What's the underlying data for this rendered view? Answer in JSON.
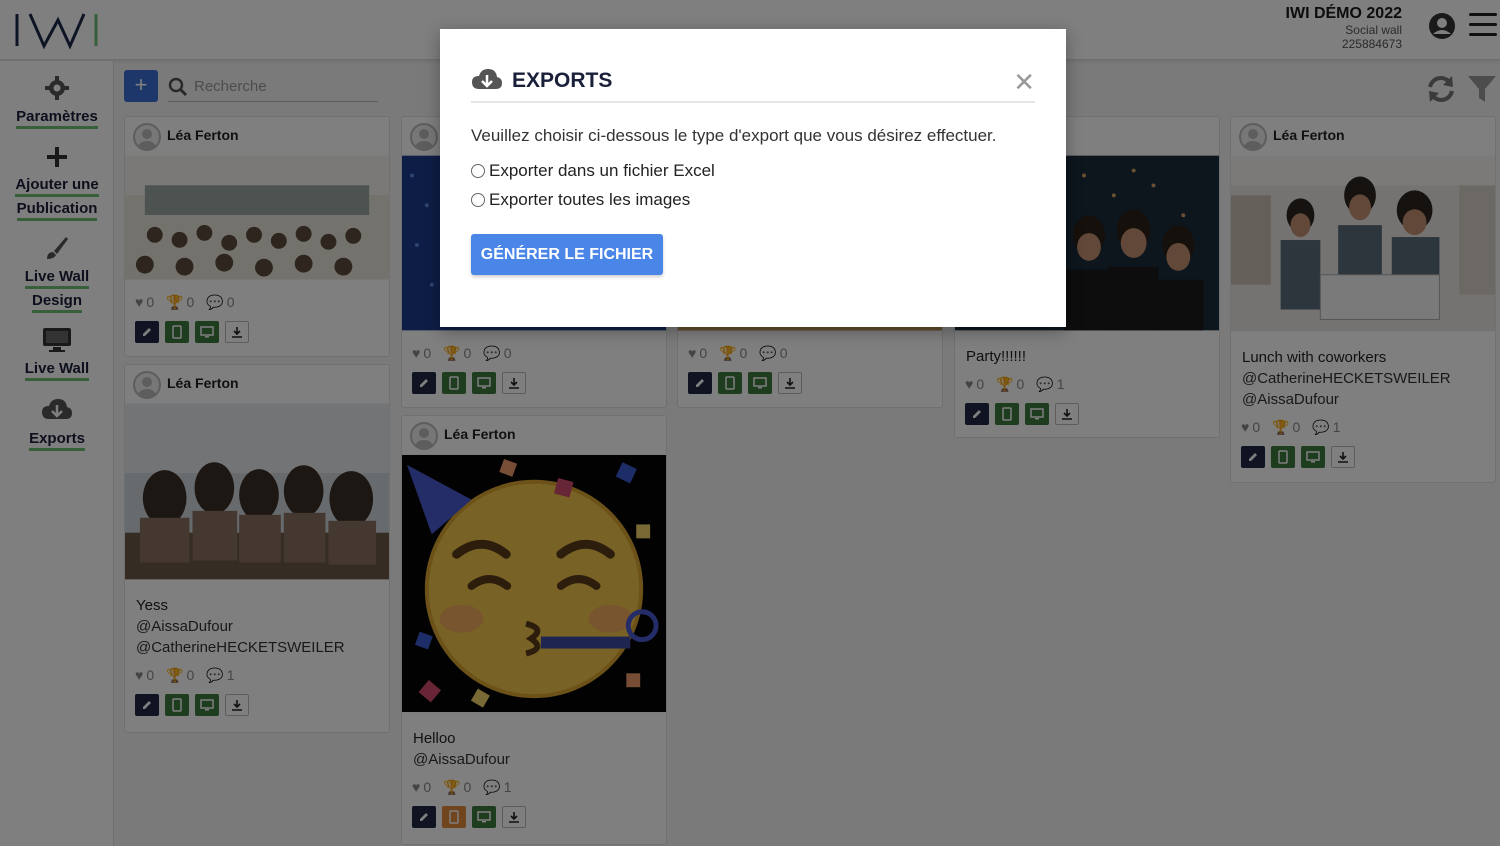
{
  "header": {
    "event_title": "IWI DÉMO 2022",
    "event_subtitle": "Social wall",
    "event_id": "225884673"
  },
  "sidebar": {
    "items": [
      {
        "label": "Paramètres",
        "icon": "gear-icon"
      },
      {
        "label_line1": "Ajouter une",
        "label_line2": "Publication",
        "icon": "plus-icon"
      },
      {
        "label_line1": "Live Wall",
        "label_line2": "Design",
        "icon": "brush-icon"
      },
      {
        "label": "Live Wall",
        "icon": "monitor-icon"
      },
      {
        "label": "Exports",
        "icon": "cloud-download-icon"
      }
    ]
  },
  "toolbar": {
    "search_placeholder": "Recherche",
    "add_label": "+"
  },
  "cards": [
    {
      "author": "Léa Ferton",
      "likes": "0",
      "trophies": "0",
      "comments": "0"
    },
    {
      "author": "Léa Ferton",
      "text": "Yess",
      "mentions": [
        "@AissaDufour",
        "@CatherineHECKETSWEILER"
      ],
      "likes": "0",
      "trophies": "0",
      "comments": "1"
    },
    {
      "author": "",
      "likes": "0",
      "trophies": "0",
      "comments": "0"
    },
    {
      "author": "Léa Ferton",
      "text": "Helloo",
      "mentions": [
        "@AissaDufour"
      ],
      "likes": "0",
      "trophies": "0",
      "comments": "1"
    },
    {
      "author": "",
      "likes": "0",
      "trophies": "0",
      "comments": "0"
    },
    {
      "author": "",
      "text": "Party!!!!!!",
      "likes": "0",
      "trophies": "0",
      "comments": "1"
    },
    {
      "author": "Léa Ferton",
      "text": "Lunch with coworkers",
      "mentions": [
        "@CatherineHECKETSWEILER",
        "@AissaDufour"
      ],
      "likes": "0",
      "trophies": "0",
      "comments": "1"
    }
  ],
  "modal": {
    "title": "EXPORTS",
    "description": "Veuillez choisir ci-dessous le type d'export que vous désirez effectuer.",
    "options": [
      "Exporter dans un fichier Excel",
      "Exporter toutes les images"
    ],
    "button": "GÉNÉRER LE FICHIER",
    "close": "✕"
  },
  "colors": {
    "accent": "#4a86e8",
    "nav_text": "#1a1f3a",
    "underline": "#6fbf73"
  }
}
